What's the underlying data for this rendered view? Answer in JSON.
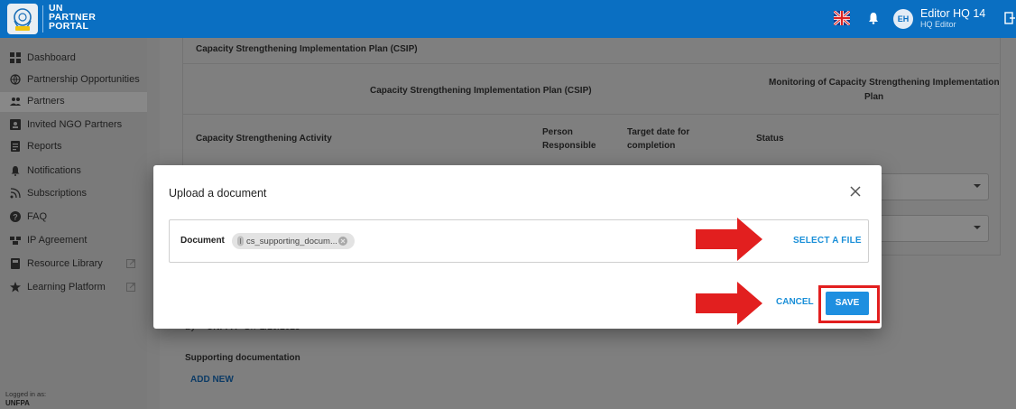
{
  "header": {
    "brand_line1": "UN",
    "brand_line2": "PARTNER",
    "brand_line3": "PORTAL",
    "avatar_initials": "EH",
    "user_name": "Editor HQ 14",
    "user_role": "HQ Editor"
  },
  "sidebar": {
    "items": [
      {
        "label": "Dashboard",
        "icon": "dashboard-icon"
      },
      {
        "label": "Partnership Opportunities",
        "icon": "globe-icon"
      },
      {
        "label": "Partners",
        "icon": "people-icon",
        "active": true
      },
      {
        "label": "Invited NGO Partners",
        "icon": "person-card-icon"
      },
      {
        "label": "Reports",
        "icon": "report-icon"
      },
      {
        "label": "Notifications",
        "icon": "bell-icon"
      },
      {
        "label": "Subscriptions",
        "icon": "rss-icon"
      },
      {
        "label": "FAQ",
        "icon": "help-icon"
      },
      {
        "label": "IP Agreement",
        "icon": "agreement-icon"
      },
      {
        "label": "Resource Library",
        "icon": "book-icon",
        "external": true
      },
      {
        "label": "Learning Platform",
        "icon": "star-icon",
        "external": true
      }
    ],
    "logged_in_label": "Logged in as:",
    "logged_in_value": "UNFPA"
  },
  "background": {
    "section_title": "Capacity Strengthening Implementation Plan (CSIP)",
    "col_group_csip": "Capacity Strengthening Implementation Plan (CSIP)",
    "col_group_monitoring_line1": "Monitoring of Capacity Strengthening Implementation",
    "col_group_monitoring_line2": "Plan",
    "col_activity": "Capacity Strengthening Activity",
    "col_person_line1": "Person",
    "col_person_line2": "Responsible",
    "col_target_line1": "Target date for",
    "col_target_line2": "completion",
    "col_status": "Status",
    "byline_prefix": "By",
    "byline_org": "UNFPA",
    "byline_on": "On",
    "byline_date": "2/20/2025",
    "supporting_label": "Supporting documentation",
    "add_new_label": "ADD NEW"
  },
  "dialog": {
    "title": "Upload a document",
    "document_label": "Document",
    "file_chip": "cs_supporting_docum...",
    "select_file_label": "SELECT A FILE",
    "cancel_label": "CANCEL",
    "save_label": "SAVE"
  },
  "colors": {
    "topbar": "#0a6fc2",
    "accent": "#1a8fd8",
    "save_button": "#1e8fe0",
    "annotation_red": "#e21f1f"
  }
}
